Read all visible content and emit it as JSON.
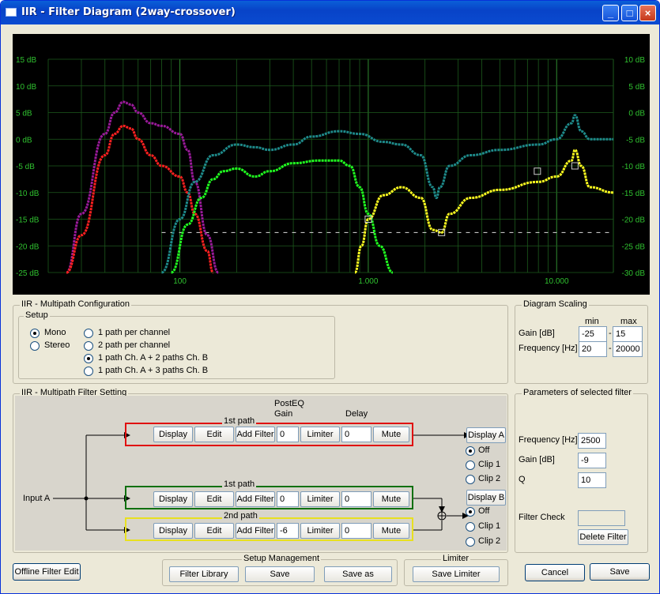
{
  "window": {
    "title": "IIR - Filter Diagram (2way-crossover)",
    "minimize": "_",
    "maximize": "□",
    "close": "×"
  },
  "chart_data": {
    "type": "line",
    "x_scale": "log",
    "xlim": [
      20,
      20000
    ],
    "ylim_left": [
      -25,
      15
    ],
    "ylim_right": [
      -30,
      10
    ],
    "grid": true,
    "y_ticks_left": [
      "15 dB",
      "10 dB",
      "5 dB",
      "0 dB",
      "-5 dB",
      "-10 dB",
      "-15 dB",
      "-20 dB",
      "-25 dB"
    ],
    "y_ticks_right": [
      "10 dB",
      "5 dB",
      "0 dB",
      "-5 dB",
      "-10 dB",
      "-15 dB",
      "-20 dB",
      "-25 dB",
      "-30 dB"
    ],
    "x_tick_labels": [
      {
        "v": 100,
        "t": "100"
      },
      {
        "v": 1000,
        "t": "1.000"
      },
      {
        "v": 10000,
        "t": "10.000"
      }
    ],
    "series": [
      {
        "color": "#9a1a9a",
        "points": [
          [
            25,
            -25
          ],
          [
            30,
            -14
          ],
          [
            40,
            1
          ],
          [
            45,
            5
          ],
          [
            50,
            7
          ],
          [
            55,
            6.5
          ],
          [
            60,
            5
          ],
          [
            70,
            3
          ],
          [
            80,
            2.5
          ],
          [
            100,
            1
          ],
          [
            110,
            -2
          ],
          [
            120,
            -8
          ],
          [
            140,
            -18
          ],
          [
            160,
            -25
          ]
        ]
      },
      {
        "color": "#ff2020",
        "points": [
          [
            25,
            -25
          ],
          [
            30,
            -18
          ],
          [
            40,
            -3
          ],
          [
            45,
            1
          ],
          [
            50,
            2.5
          ],
          [
            55,
            2
          ],
          [
            60,
            0
          ],
          [
            70,
            -3
          ],
          [
            80,
            -5
          ],
          [
            100,
            -7
          ],
          [
            110,
            -10
          ],
          [
            120,
            -14
          ],
          [
            140,
            -21
          ],
          [
            150,
            -25
          ]
        ]
      },
      {
        "color": "#1e8a8a",
        "points": [
          [
            80,
            -25
          ],
          [
            100,
            -15
          ],
          [
            120,
            -8
          ],
          [
            150,
            -3
          ],
          [
            200,
            -1
          ],
          [
            250,
            -1.5
          ],
          [
            300,
            -2
          ],
          [
            400,
            -1
          ],
          [
            500,
            0.5
          ],
          [
            700,
            1.5
          ],
          [
            900,
            1
          ],
          [
            1200,
            -0.5
          ],
          [
            1500,
            -1
          ],
          [
            1900,
            -3
          ],
          [
            2200,
            -9
          ],
          [
            2300,
            -11
          ],
          [
            2400,
            -9
          ],
          [
            2700,
            -5
          ],
          [
            3500,
            -3
          ],
          [
            5000,
            -2
          ],
          [
            8000,
            -1
          ],
          [
            10000,
            0
          ],
          [
            12000,
            3
          ],
          [
            12500,
            4.5
          ],
          [
            13500,
            1.5
          ],
          [
            15000,
            0
          ],
          [
            20000,
            0
          ]
        ]
      },
      {
        "color": "#20ff20",
        "points": [
          [
            90,
            -25
          ],
          [
            110,
            -16
          ],
          [
            130,
            -11
          ],
          [
            150,
            -7.5
          ],
          [
            170,
            -6
          ],
          [
            200,
            -5.5
          ],
          [
            250,
            -7
          ],
          [
            300,
            -6
          ],
          [
            400,
            -4.5
          ],
          [
            550,
            -4
          ],
          [
            700,
            -4
          ],
          [
            800,
            -5
          ],
          [
            900,
            -9
          ],
          [
            1000,
            -14
          ],
          [
            1150,
            -20
          ],
          [
            1350,
            -25
          ]
        ]
      },
      {
        "color": "#ffff20",
        "points": [
          [
            850,
            -25
          ],
          [
            920,
            -20
          ],
          [
            1000,
            -15
          ],
          [
            1200,
            -10.5
          ],
          [
            1500,
            -9
          ],
          [
            1900,
            -11
          ],
          [
            2200,
            -17
          ],
          [
            2450,
            -17.5
          ],
          [
            2700,
            -14
          ],
          [
            3500,
            -11
          ],
          [
            5000,
            -9.5
          ],
          [
            8000,
            -8
          ],
          [
            10000,
            -7
          ],
          [
            12000,
            -4
          ],
          [
            12500,
            -2
          ],
          [
            13500,
            -5
          ],
          [
            15000,
            -9
          ],
          [
            20000,
            -10
          ]
        ]
      }
    ],
    "markers": [
      [
        1000,
        -15
      ],
      [
        2450,
        -17.5
      ],
      [
        7900,
        -6
      ],
      [
        12500,
        -5
      ]
    ],
    "dashed_level": -17.5
  },
  "multipath": {
    "title": "IIR - Multipath Configuration",
    "setup_title": "Setup",
    "mono": "Mono",
    "stereo": "Stereo",
    "opt1": "1 path per channel",
    "opt2": "2 path per channel",
    "opt3": "1 path Ch. A + 2 paths Ch. B",
    "opt4": "1 path Ch. A + 3 paths Ch. B"
  },
  "scaling": {
    "title": "Diagram Scaling",
    "min": "min",
    "max": "max",
    "gain_label": "Gain [dB]",
    "gain_min": "-25",
    "gain_max": "15",
    "freq_label": "Frequency [Hz]",
    "freq_min": "20",
    "freq_max": "20000",
    "sep": "-"
  },
  "filter_setting": {
    "title": "IIR -  Multipath Filter Setting",
    "posteq": "PostEQ",
    "gain": "Gain",
    "delay": "Delay",
    "input": "Input A",
    "paths": [
      {
        "label": "1st path",
        "gain": "0",
        "delay": "0"
      },
      {
        "label": "1st path",
        "gain": "0",
        "delay": "0"
      },
      {
        "label": "2nd path",
        "gain": "-6",
        "delay": "0"
      }
    ],
    "display": "Display",
    "edit": "Edit",
    "add_filter": "Add Filter",
    "limiter": "Limiter",
    "mute": "Mute",
    "display_a": "Display A",
    "display_b": "Display B",
    "off": "Off",
    "clip1": "Clip 1",
    "clip2": "Clip 2"
  },
  "params": {
    "title": "Parameters of selected filter",
    "freq_label": "Frequency [Hz]",
    "freq": "2500",
    "gain_label": "Gain [dB]",
    "gain": "-9",
    "q_label": "Q",
    "q": "10",
    "check_label": "Filter Check",
    "delete": "Delete Filter"
  },
  "bottom": {
    "offline": "Offline Filter Edit",
    "setup_mgmt": "Setup Management",
    "filter_library": "Filter Library",
    "save": "Save",
    "save_as": "Save as",
    "limiter_title": "Limiter",
    "save_limiter": "Save Limiter",
    "cancel": "Cancel",
    "save_main": "Save"
  }
}
